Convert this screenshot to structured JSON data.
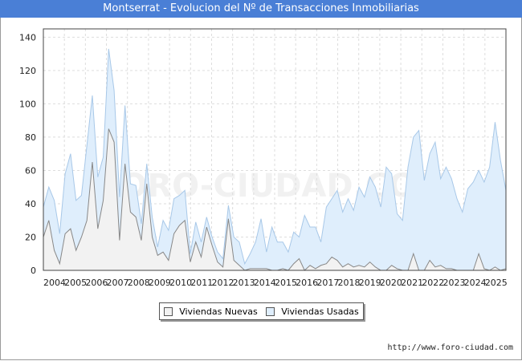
{
  "title": "Montserrat - Evolucion del Nº de Transacciones Inmobiliarias",
  "source": "http://www.foro-ciudad.com",
  "watermark": "FORO-CIUDAD.COM",
  "chart_data": {
    "type": "area",
    "x_categories": [
      "2004",
      "2005",
      "2006",
      "2007",
      "2008",
      "2009",
      "2010",
      "2011",
      "2012",
      "2013",
      "2014",
      "2015",
      "2016",
      "2017",
      "2018",
      "2019",
      "2020",
      "2021",
      "2022",
      "2023",
      "2024",
      "2025"
    ],
    "ylim": [
      0,
      145
    ],
    "yticks": [
      0,
      20,
      40,
      60,
      80,
      100,
      120,
      140
    ],
    "grid": true,
    "legend_position": "bottom",
    "series": [
      {
        "name": "Viviendas Nuevas",
        "color": "#888888",
        "fill": "#f2f2f2",
        "values": [
          20,
          30,
          12,
          4,
          22,
          25,
          12,
          20,
          30,
          65,
          25,
          42,
          85,
          77,
          18,
          64,
          35,
          32,
          18,
          52,
          20,
          9,
          11,
          6,
          22,
          27,
          30,
          5,
          17,
          8,
          26,
          15,
          5,
          2,
          31,
          6,
          3,
          0,
          1,
          1,
          1,
          1,
          0,
          0,
          1,
          0,
          4,
          7,
          0,
          3,
          1,
          3,
          4,
          8,
          6,
          2,
          4,
          2,
          3,
          2,
          5,
          2,
          0,
          0,
          3,
          1,
          0,
          0,
          10,
          0,
          0,
          6,
          2,
          3,
          1,
          1,
          0,
          0,
          0,
          0,
          10,
          1,
          0,
          2,
          0,
          1
        ]
      },
      {
        "name": "Viviendas Usadas",
        "color": "#a8c8e8",
        "fill": "#dfeefc",
        "values": [
          38,
          50,
          42,
          22,
          58,
          70,
          42,
          45,
          75,
          105,
          56,
          68,
          133,
          108,
          44,
          99,
          52,
          51,
          28,
          64,
          32,
          14,
          30,
          24,
          43,
          45,
          48,
          10,
          29,
          17,
          32,
          20,
          11,
          7,
          39,
          20,
          17,
          4,
          10,
          17,
          31,
          11,
          26,
          17,
          17,
          11,
          23,
          20,
          33,
          26,
          26,
          17,
          38,
          43,
          48,
          35,
          43,
          36,
          50,
          44,
          56,
          50,
          38,
          62,
          58,
          34,
          30,
          62,
          80,
          84,
          54,
          70,
          77,
          55,
          62,
          55,
          43,
          35,
          49,
          53,
          60,
          53,
          62,
          89,
          66,
          48
        ]
      }
    ]
  }
}
